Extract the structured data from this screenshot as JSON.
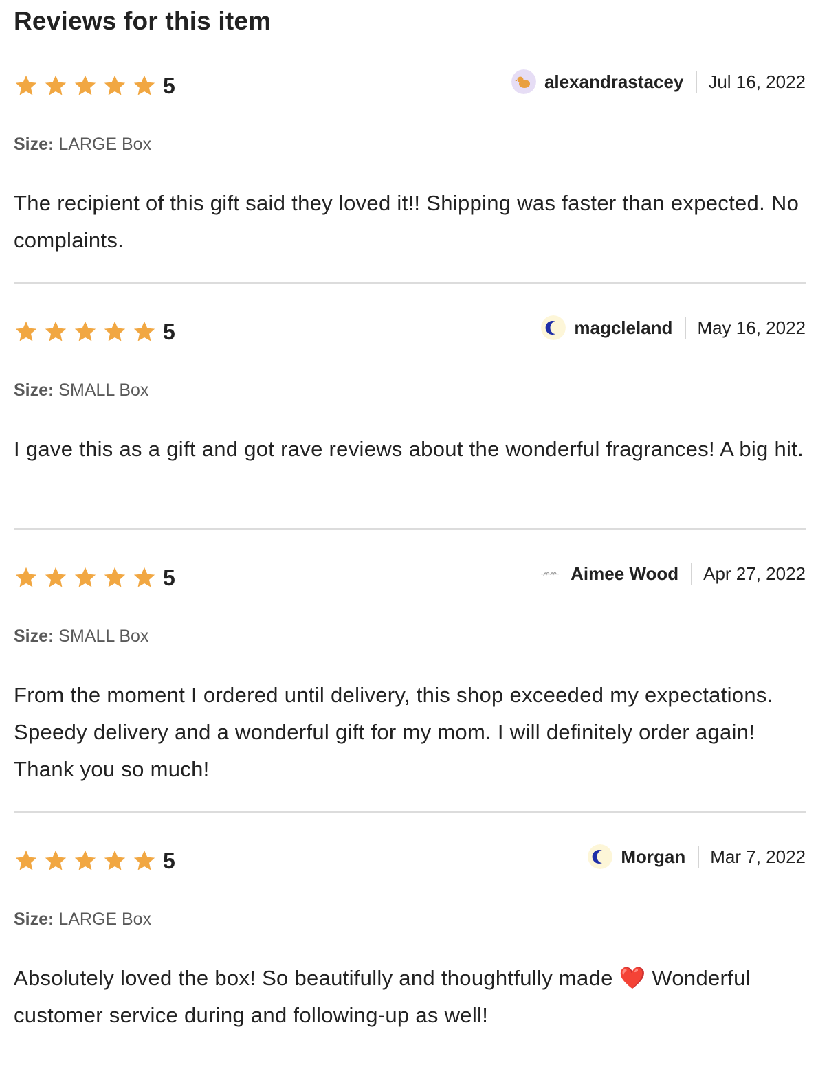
{
  "section": {
    "title": "Reviews for this item"
  },
  "colors": {
    "star": "#F1A742",
    "divider": "#DCDCDC",
    "meta_text": "#595959"
  },
  "reviews": [
    {
      "rating": "5",
      "stars_filled": 5,
      "reviewer": "alexandrastacey",
      "avatar_icon": "bird-avatar-icon",
      "date": "Jul 16, 2022",
      "size_label": "Size:",
      "size_value": "LARGE Box",
      "text": "The recipient of this gift said they loved it!! Shipping was faster than expected. No complaints."
    },
    {
      "rating": "5",
      "stars_filled": 5,
      "reviewer": "magcleland",
      "avatar_icon": "crescent-avatar-icon",
      "date": "May 16, 2022",
      "size_label": "Size:",
      "size_value": "SMALL Box",
      "text": "I gave this as a gift and got rave reviews about the wonderful fragrances! A big hit."
    },
    {
      "rating": "5",
      "stars_filled": 5,
      "reviewer": "Aimee Wood",
      "avatar_icon": "monogram-avatar-icon",
      "date": "Apr 27, 2022",
      "size_label": "Size:",
      "size_value": "SMALL Box",
      "text": "From the moment I ordered until delivery, this shop exceeded my expectations. Speedy delivery and a wonderful gift for my mom. I will definitely order again! Thank you so much!"
    },
    {
      "rating": "5",
      "stars_filled": 5,
      "reviewer": "Morgan",
      "avatar_icon": "crescent-avatar-icon",
      "date": "Mar 7, 2022",
      "size_label": "Size:",
      "size_value": "LARGE Box",
      "text": "Absolutely loved the box! So beautifully and thoughtfully made ❤️ Wonderful customer service during and following-up as well!"
    }
  ]
}
